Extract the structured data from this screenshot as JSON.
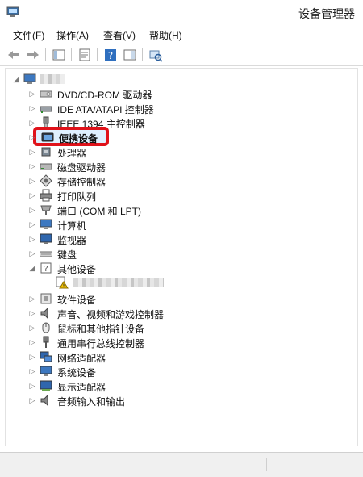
{
  "window": {
    "title": "设备管理器",
    "icon": "device-manager-icon"
  },
  "menu": {
    "items": [
      {
        "label": "文件(F)"
      },
      {
        "label": "操作(A)"
      },
      {
        "label": "查看(V)"
      },
      {
        "label": "帮助(H)"
      }
    ]
  },
  "toolbar": {
    "buttons": [
      "back-arrow-icon",
      "forward-arrow-icon",
      "show-hide-tree-icon",
      "properties-icon",
      "help-icon",
      "action-pane-icon",
      "scan-hardware-icon"
    ]
  },
  "tree": {
    "root": {
      "label_redacted": true,
      "icon": "computer-icon"
    },
    "categories": [
      {
        "label": "DVD/CD-ROM 驱动器",
        "icon": "dvd-drive-icon",
        "expanded": false
      },
      {
        "label": "IDE ATA/ATAPI 控制器",
        "icon": "ide-controller-icon",
        "expanded": false
      },
      {
        "label": "IEEE 1394 主控制器",
        "icon": "ieee1394-icon",
        "expanded": false
      },
      {
        "label": "便携设备",
        "icon": "portable-device-icon",
        "expanded": false,
        "selected": true
      },
      {
        "label": "处理器",
        "icon": "processor-icon",
        "expanded": false
      },
      {
        "label": "磁盘驱动器",
        "icon": "disk-drive-icon",
        "expanded": false
      },
      {
        "label": "存储控制器",
        "icon": "storage-controller-icon",
        "expanded": false
      },
      {
        "label": "打印队列",
        "icon": "printer-icon",
        "expanded": false
      },
      {
        "label": "端口 (COM 和 LPT)",
        "icon": "port-icon",
        "expanded": false
      },
      {
        "label": "计算机",
        "icon": "computer-icon",
        "expanded": false
      },
      {
        "label": "监视器",
        "icon": "monitor-icon",
        "expanded": false
      },
      {
        "label": "键盘",
        "icon": "keyboard-icon",
        "expanded": false
      },
      {
        "label": "其他设备",
        "icon": "other-devices-icon",
        "expanded": true
      },
      {
        "label_redacted": true,
        "icon": "unknown-device-warning-icon",
        "child": true
      },
      {
        "label": "软件设备",
        "icon": "software-device-icon",
        "expanded": false
      },
      {
        "label": "声音、视频和游戏控制器",
        "icon": "sound-icon",
        "expanded": false
      },
      {
        "label": "鼠标和其他指针设备",
        "icon": "mouse-icon",
        "expanded": false
      },
      {
        "label": "通用串行总线控制器",
        "icon": "usb-icon",
        "expanded": false
      },
      {
        "label": "网络适配器",
        "icon": "network-adapter-icon",
        "expanded": false
      },
      {
        "label": "系统设备",
        "icon": "system-device-icon",
        "expanded": false
      },
      {
        "label": "显示适配器",
        "icon": "display-adapter-icon",
        "expanded": false
      },
      {
        "label": "音频输入和输出",
        "icon": "audio-io-icon",
        "expanded": false
      }
    ]
  },
  "colors": {
    "highlight_border": "#e0121a",
    "selection_fill": "#dff0ff"
  }
}
